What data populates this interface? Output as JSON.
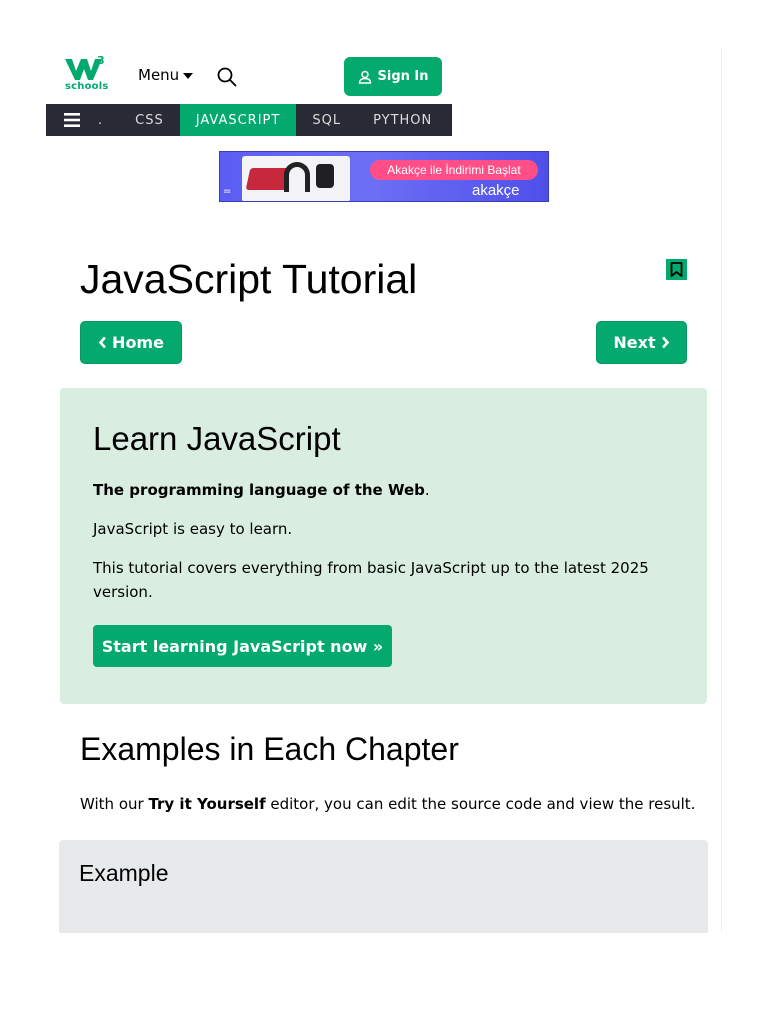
{
  "header": {
    "logo": {
      "superscript": "3",
      "wordmark": "schools",
      "icon": "w3schools-logo-icon"
    },
    "menu_label": "Menu",
    "search_icon": "search-icon",
    "signin_label": "Sign In",
    "signin_icon": "user-icon",
    "accent_color": "#04AA6D"
  },
  "navbar": {
    "menu_icon": "hamburger-icon",
    "dot": ".",
    "items": [
      {
        "label": "CSS",
        "active": false
      },
      {
        "label": "JAVASCRIPT",
        "active": true
      },
      {
        "label": "SQL",
        "active": false
      },
      {
        "label": "PYTHON",
        "active": false
      }
    ],
    "background_color": "#282A35"
  },
  "ad": {
    "cta": "Akakçe ile İndirimi Başlat",
    "brand": "akakçe",
    "marker": "="
  },
  "page": {
    "title": "JavaScript Tutorial",
    "bookmark_icon": "bookmark-icon",
    "home_label": "Home",
    "next_label": "Next",
    "prev_icon": "chevron-left-icon",
    "next_icon": "chevron-right-icon"
  },
  "learn": {
    "heading": "Learn JavaScript",
    "tagline_bold": "The programming language of the Web",
    "tagline_end": ".",
    "p2": "JavaScript is easy to learn.",
    "p3": "This tutorial covers everything from basic JavaScript up to the latest 2025 version.",
    "start_button": "Start learning JavaScript now »",
    "background_color": "#D9EEE1"
  },
  "examples": {
    "heading": "Examples in Each Chapter",
    "text_before": "With our ",
    "text_bold": "Try it Yourself",
    "text_after": " editor, you can edit the source code and view the result."
  },
  "example_box": {
    "heading": "Example",
    "background_color": "#E7E9EB"
  }
}
